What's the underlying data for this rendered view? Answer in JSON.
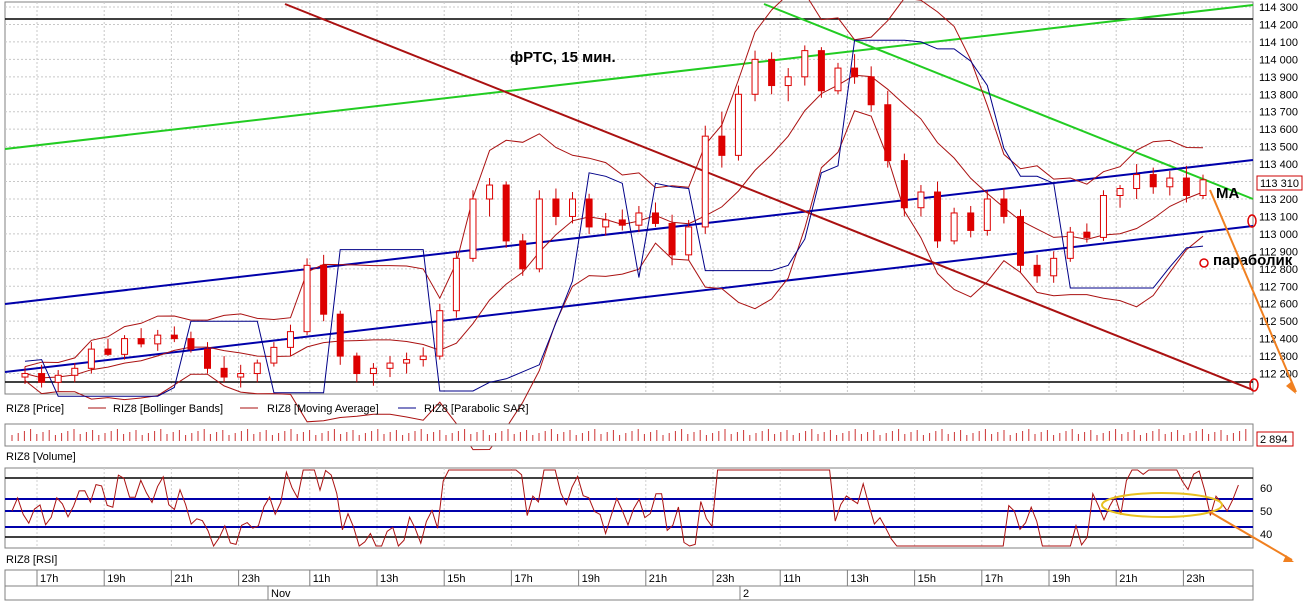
{
  "chart_data": {
    "type": "candlestick",
    "title": "фРТС, 15 мин.",
    "instrument": "RIZ8",
    "price_axis": {
      "min": 112100,
      "max": 114300,
      "ticks": [
        "114 300",
        "114 200",
        "114 100",
        "114 000",
        "113 900",
        "113 800",
        "113 700",
        "113 600",
        "113 500",
        "113 400",
        "113 300",
        "113 200",
        "113 100",
        "113 000",
        "112 900",
        "112 800",
        "112 700",
        "112 600",
        "112 500",
        "112 400",
        "112 300",
        "112 200"
      ],
      "last_price_label": "113 310"
    },
    "time_axis": {
      "ticks": [
        "17h",
        "19h",
        "21h",
        "23h",
        "11h",
        "13h",
        "15h",
        "17h",
        "19h",
        "21h",
        "23h",
        "11h",
        "13h",
        "15h",
        "17h",
        "19h",
        "21h",
        "23h"
      ],
      "dates": [
        "Nov",
        "2"
      ]
    },
    "legend": [
      "RIZ8 [Price]",
      "RIZ8 [Bollinger Bands]",
      "RIZ8 [Moving Average]",
      "RIZ8 [Parabolic SAR]"
    ],
    "volume_panel": {
      "label": "RIZ8 [Volume]",
      "last_value": "2 894"
    },
    "rsi_panel": {
      "label": "RIZ8 [RSI]",
      "ticks": [
        "60",
        "50",
        "40"
      ]
    },
    "annotations": {
      "ma": "MA",
      "parabolic": "параболик"
    },
    "candles": [
      [
        112180,
        112240,
        112140,
        112200
      ],
      [
        112200,
        112250,
        112120,
        112150
      ],
      [
        112150,
        112220,
        112100,
        112190
      ],
      [
        112190,
        112260,
        112150,
        112230
      ],
      [
        112230,
        112380,
        112200,
        112340
      ],
      [
        112340,
        112400,
        112300,
        112310
      ],
      [
        112310,
        112420,
        112280,
        112400
      ],
      [
        112400,
        112460,
        112350,
        112370
      ],
      [
        112370,
        112450,
        112330,
        112420
      ],
      [
        112420,
        112470,
        112380,
        112400
      ],
      [
        112400,
        112440,
        112320,
        112340
      ],
      [
        112340,
        112380,
        112200,
        112230
      ],
      [
        112230,
        112300,
        112150,
        112180
      ],
      [
        112180,
        112250,
        112120,
        112200
      ],
      [
        112200,
        112280,
        112150,
        112260
      ],
      [
        112260,
        112380,
        112240,
        112350
      ],
      [
        112350,
        112480,
        112300,
        112440
      ],
      [
        112440,
        112860,
        112420,
        112820
      ],
      [
        112820,
        112880,
        112500,
        112540
      ],
      [
        112540,
        112560,
        112250,
        112300
      ],
      [
        112300,
        112320,
        112150,
        112200
      ],
      [
        112200,
        112260,
        112130,
        112230
      ],
      [
        112230,
        112300,
        112180,
        112260
      ],
      [
        112260,
        112320,
        112200,
        112280
      ],
      [
        112280,
        112350,
        112240,
        112300
      ],
      [
        112300,
        112600,
        112280,
        112560
      ],
      [
        112560,
        112900,
        112520,
        112860
      ],
      [
        112860,
        113250,
        112840,
        113200
      ],
      [
        113200,
        113320,
        113100,
        113280
      ],
      [
        113280,
        113300,
        112920,
        112960
      ],
      [
        112960,
        113000,
        112760,
        112800
      ],
      [
        112800,
        113250,
        112780,
        113200
      ],
      [
        113200,
        113260,
        113050,
        113100
      ],
      [
        113100,
        113240,
        113060,
        113200
      ],
      [
        113200,
        113230,
        113000,
        113040
      ],
      [
        113040,
        113120,
        112990,
        113080
      ],
      [
        113080,
        113140,
        113020,
        113050
      ],
      [
        113050,
        113160,
        113010,
        113120
      ],
      [
        113120,
        113180,
        113040,
        113060
      ],
      [
        113060,
        113110,
        112820,
        112880
      ],
      [
        112880,
        113080,
        112850,
        113040
      ],
      [
        113040,
        113620,
        113000,
        113560
      ],
      [
        113560,
        113700,
        113380,
        113450
      ],
      [
        113450,
        113850,
        113420,
        113800
      ],
      [
        113800,
        114050,
        113760,
        114000
      ],
      [
        114000,
        114040,
        113800,
        113850
      ],
      [
        113850,
        113950,
        113760,
        113900
      ],
      [
        113900,
        114080,
        113850,
        114050
      ],
      [
        114050,
        114070,
        113780,
        113820
      ],
      [
        113820,
        113980,
        113800,
        113950
      ],
      [
        113950,
        114030,
        113860,
        113900
      ],
      [
        113900,
        113960,
        113700,
        113740
      ],
      [
        113740,
        113820,
        113380,
        113420
      ],
      [
        113420,
        113460,
        113100,
        113150
      ],
      [
        113150,
        113280,
        113100,
        113240
      ],
      [
        113240,
        113300,
        112920,
        112960
      ],
      [
        112960,
        113150,
        112940,
        113120
      ],
      [
        113120,
        113160,
        112980,
        113020
      ],
      [
        113020,
        113250,
        112990,
        113200
      ],
      [
        113200,
        113260,
        113060,
        113100
      ],
      [
        113100,
        113140,
        112780,
        112820
      ],
      [
        112820,
        112880,
        112720,
        112760
      ],
      [
        112760,
        112900,
        112720,
        112860
      ],
      [
        112860,
        113040,
        112840,
        113010
      ],
      [
        113010,
        113060,
        112950,
        112980
      ],
      [
        112980,
        113250,
        112960,
        113220
      ],
      [
        113220,
        113280,
        113150,
        113260
      ],
      [
        113260,
        113400,
        113200,
        113340
      ],
      [
        113340,
        113380,
        113230,
        113270
      ],
      [
        113270,
        113360,
        113220,
        113320
      ],
      [
        113320,
        113390,
        113180,
        113220
      ],
      [
        113220,
        113340,
        113200,
        113310
      ]
    ]
  }
}
